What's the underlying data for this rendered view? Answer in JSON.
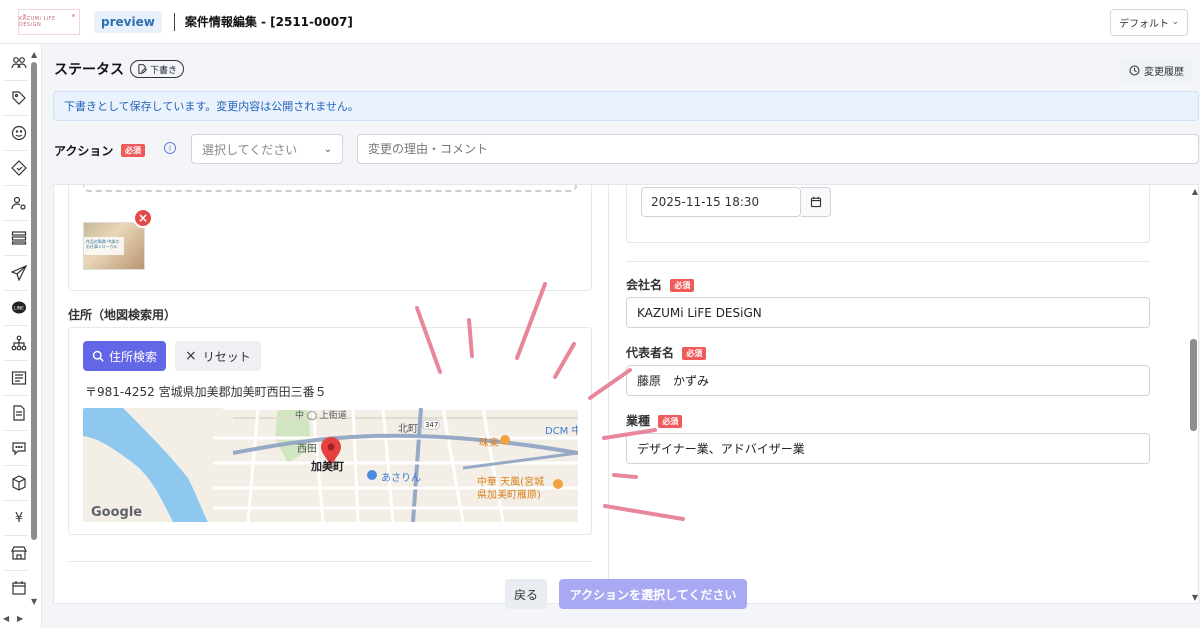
{
  "header": {
    "logo_text": "KAZUMi LiFE DESiGN",
    "preview_badge": "preview",
    "title": "案件情報編集 - [2511-0007]",
    "view_select": "デフォルト"
  },
  "status": {
    "label": "ステータス",
    "draft_pill": "下書き",
    "history_button": "変更履歴"
  },
  "banner": {
    "text": "下書きとして保存しています。変更内容は公開されません。"
  },
  "action": {
    "label": "アクション",
    "required": "必須",
    "select_placeholder": "選択してください",
    "comment_placeholder": "変更の理由・コメント"
  },
  "thumbnail": {
    "caption": "作品の軌跡 中部のお仕事×ローカル"
  },
  "address": {
    "label": "住所（地図検索用）",
    "search_button": "住所検索",
    "reset_button": "リセット",
    "address_text": "〒981-4252 宮城県加美郡加美町西田三番５",
    "map": {
      "labels": {
        "town": "加美町",
        "nishida": "西田",
        "kitamachi": "北町",
        "misaki": "味楽",
        "dcm": "DCM 中",
        "asarin": "あさりん",
        "tenpu_1": "中華 天風(宮城",
        "tenpu_2": "県加美町雁原)",
        "street": "中 ◯ 上街道",
        "route": "347"
      },
      "attribution": "Google"
    }
  },
  "right": {
    "datetime_value": "2025-11-15 18:30",
    "company": {
      "label": "会社名",
      "required": "必須",
      "value": "KAZUMi LiFE DESiGN"
    },
    "representative": {
      "label": "代表者名",
      "required": "必須",
      "value": "藤原　かずみ"
    },
    "industry": {
      "label": "業種",
      "required": "必須",
      "value": "デザイナー業、アドバイザー業"
    }
  },
  "footer": {
    "back_button": "戻る",
    "action_button": "アクションを選択してください"
  },
  "colors": {
    "primary": "#6466e8",
    "primary_disabled": "#a9a8f3",
    "required": "#ef5b5b",
    "banner_text": "#2563b8",
    "annotation": "#e8869b"
  }
}
